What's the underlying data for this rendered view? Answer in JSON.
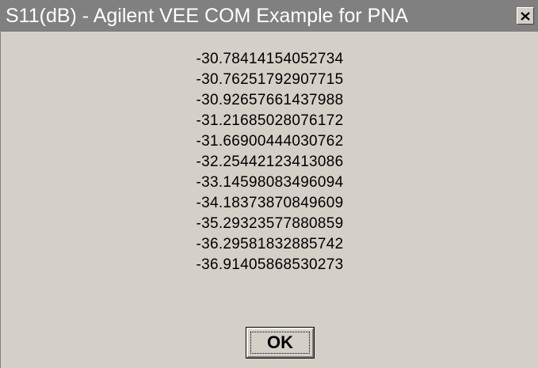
{
  "window": {
    "title": "S11(dB) - Agilent VEE COM Example for PNA",
    "close_icon": "close-icon"
  },
  "values": [
    "-30.78414154052734",
    "-30.76251792907715",
    "-30.92657661437988",
    "-31.21685028076172",
    "-31.66900444030762",
    "-32.25442123413086",
    "-33.14598083496094",
    "-34.18373870849609",
    "-35.29323577880859",
    "-36.29581832885742",
    "-36.91405868530273"
  ],
  "buttons": {
    "ok_label": "OK"
  },
  "colors": {
    "titlebar": "#808080",
    "title_text": "#ffffff",
    "dialog_bg": "#d4d0c8"
  }
}
